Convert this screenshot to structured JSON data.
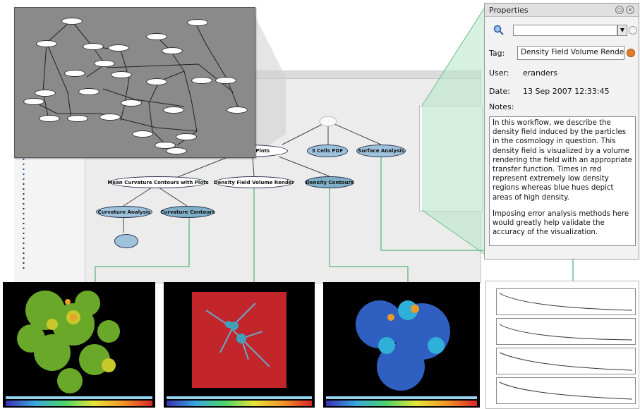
{
  "workflow": {
    "nodes": [
      {
        "id": "shape-plots",
        "label": "with Shape Plots",
        "style": "white"
      },
      {
        "id": "3pdf",
        "label": "3 Cells PDF",
        "style": "blue"
      },
      {
        "id": "surface",
        "label": "Surface Analysis",
        "style": "blue"
      },
      {
        "id": "mean-curv",
        "label": "Mean Curvature Contours with Plots",
        "style": "white"
      },
      {
        "id": "density-field",
        "label": "Density Field Volume Render",
        "style": "white"
      },
      {
        "id": "density-contours",
        "label": "Density Contours",
        "style": "teal"
      },
      {
        "id": "curv-analysis",
        "label": "Curvature Analysis",
        "style": "blue"
      },
      {
        "id": "curv-contours",
        "label": "Curvature Contours",
        "style": "teal"
      },
      {
        "id": "leaf",
        "label": "",
        "style": "blue"
      }
    ]
  },
  "properties": {
    "title": "Properties",
    "search_value": "",
    "tag_label": "Tag:",
    "tag_value": "Density Field Volume Render",
    "user_label": "User:",
    "user_value": "eranders",
    "date_label": "Date:",
    "date_value": "13 Sep 2007 12:33:45",
    "notes_label": "Notes:",
    "notes_p1": "In this workflow, we describe the density field induced by the particles in the cosmology in question.  This density field is visualized by a volume rendering the field with an appropriate transfer function.  Times in red represent extremely low density regions whereas blue hues depict areas of high density.",
    "notes_p2": "Imposing error analysis methods here would greatly help validate the accuracy of the visualization."
  },
  "colors": {
    "node_white": "#ffffff",
    "node_blue": "#9fc2dc",
    "node_teal": "#7fb0c8",
    "connector_green": "#6cbf8a",
    "tag_reset": "#e37b2c"
  },
  "icons": [
    "search-icon",
    "dropdown-icon",
    "clear-icon",
    "reset-icon",
    "pin-icon",
    "close-icon"
  ]
}
